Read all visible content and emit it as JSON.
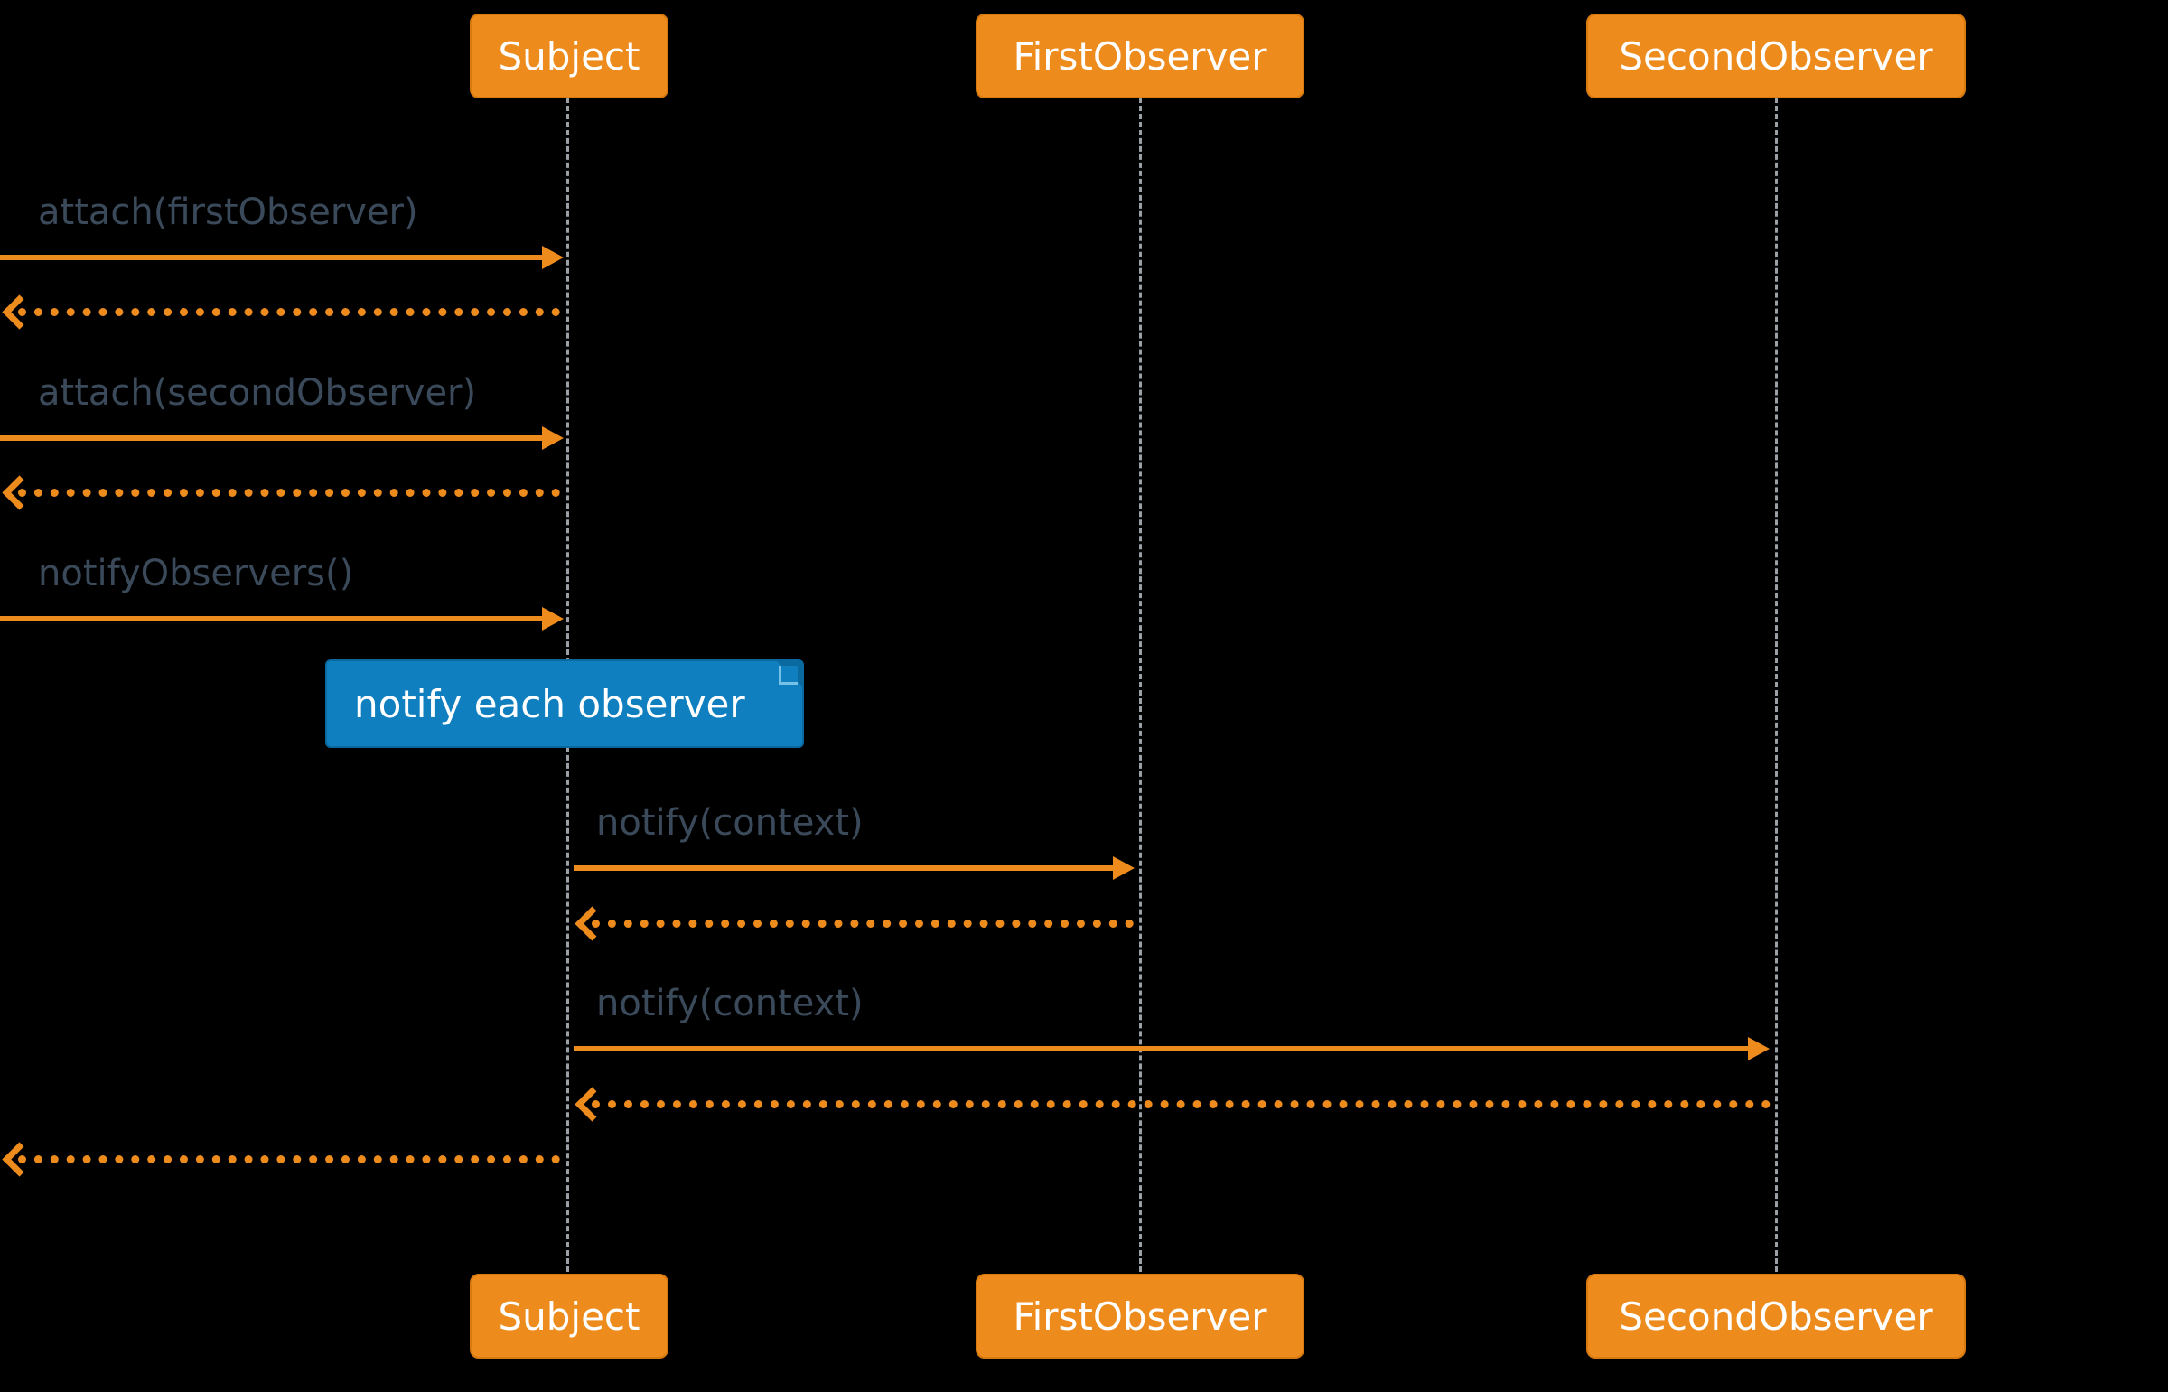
{
  "participants": {
    "subject": {
      "label": "Subject"
    },
    "first": {
      "label": "FirstObserver"
    },
    "second": {
      "label": "SecondObserver"
    }
  },
  "messages": {
    "attach_first": {
      "label": "attach(firstObserver)"
    },
    "attach_second": {
      "label": "attach(secondObserver)"
    },
    "notify_obs": {
      "label": "notifyObservers()"
    },
    "notify_ctx_1": {
      "label": "notify(context)"
    },
    "notify_ctx_2": {
      "label": "notify(context)"
    }
  },
  "note": {
    "text": "notify each observer"
  },
  "colors": {
    "actor_fill": "#ed8b1d",
    "actor_border": "#d87a0f",
    "arrow": "#ed8b1d",
    "lifeline": "#9aa0a6",
    "text": "#3b4a5a",
    "note_fill": "#0f7fbf",
    "note_border": "#0a6aa0"
  }
}
